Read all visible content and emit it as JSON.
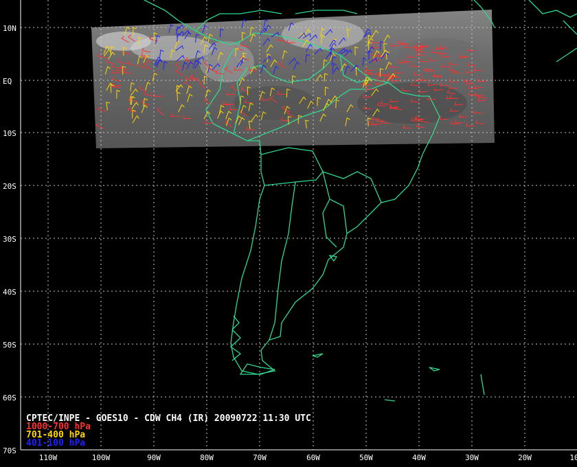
{
  "caption": {
    "title": "CPTEC/INPE - GOES10 - CDW CH4 (IR) 20090722 11:30 UTC"
  },
  "legend": [
    {
      "label": "1000-700 hPa",
      "color": "#ff3030"
    },
    {
      "label": "701-400 hPa",
      "color": "#ffd800"
    },
    {
      "label": "401-100 hPa",
      "color": "#2020ff"
    }
  ],
  "latitude_labels": [
    "10N",
    "EQ",
    "10S",
    "20S",
    "30S",
    "40S",
    "50S",
    "60S",
    "70S"
  ],
  "longitude_labels": [
    "110W",
    "100W",
    "90W",
    "80W",
    "70W",
    "60W",
    "50W",
    "40W",
    "30W",
    "20W",
    "10"
  ],
  "colors": {
    "background": "#000000",
    "coastline": "#30d890",
    "grid": "#c8c8c8",
    "satellite_strip": "#7a7a7a"
  }
}
